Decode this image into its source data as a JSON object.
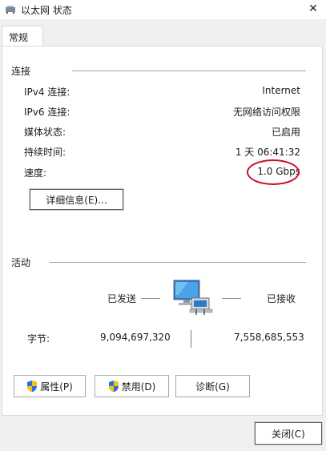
{
  "window": {
    "title": "以太网 状态"
  },
  "tab": {
    "label": "常规"
  },
  "connection": {
    "heading": "连接",
    "rows": [
      {
        "label": "IPv4 连接:",
        "value": "Internet"
      },
      {
        "label": "IPv6 连接:",
        "value": "无网络访问权限"
      },
      {
        "label": "媒体状态:",
        "value": "已启用"
      },
      {
        "label": "持续时间:",
        "value": "1 天 06:41:32"
      },
      {
        "label": "速度:",
        "value": "1.0 Gbps"
      }
    ],
    "details_button": "详细信息(E)..."
  },
  "activity": {
    "heading": "活动",
    "sent_label": "已发送",
    "received_label": "已接收",
    "bytes_label": "字节:",
    "bytes_sent": "9,094,697,320",
    "bytes_received": "7,558,685,553"
  },
  "buttons": {
    "properties": "属性(P)",
    "disable": "禁用(D)",
    "diagnose": "诊断(G)",
    "close": "关闭(C)"
  },
  "icons": [
    "network-adapter-icon",
    "close-icon",
    "shield-icon",
    "computer-network-icon"
  ],
  "colors": {
    "highlight_oval": "#c8102e",
    "window_bg": "#f0f0f0"
  }
}
